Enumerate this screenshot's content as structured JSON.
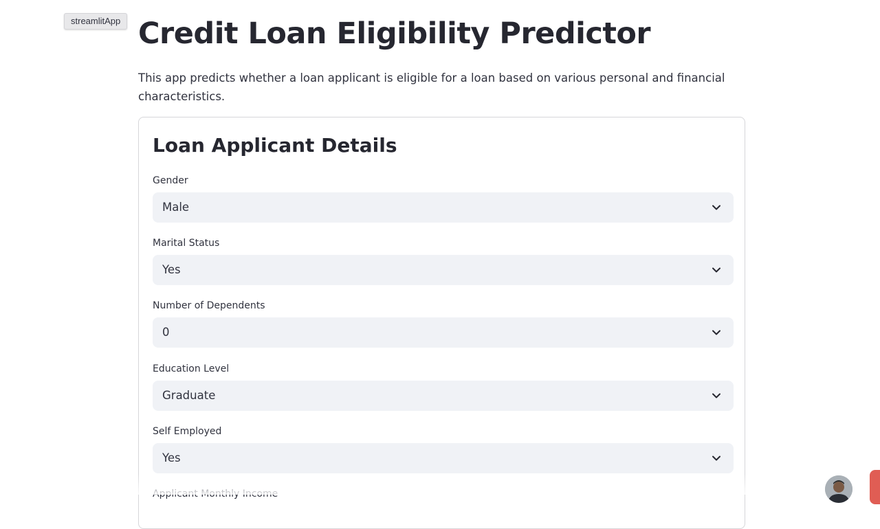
{
  "tooltip": {
    "label": "streamlitApp"
  },
  "header": {
    "title": "Credit Loan Eligibility Predictor",
    "description": "This app predicts whether a loan applicant is eligible for a loan based on various personal and financial characteristics."
  },
  "form": {
    "heading": "Loan Applicant Details",
    "fields": [
      {
        "label": "Gender",
        "value": "Male"
      },
      {
        "label": "Marital Status",
        "value": "Yes"
      },
      {
        "label": "Number of Dependents",
        "value": "0"
      },
      {
        "label": "Education Level",
        "value": "Graduate"
      },
      {
        "label": "Self Employed",
        "value": "Yes"
      },
      {
        "label": "Applicant Monthly Income"
      }
    ]
  },
  "icons": {
    "dropdown": "chevron-down-icon",
    "profile": "avatar",
    "action": "red-action-button"
  },
  "colors": {
    "select_bg": "#f0f2f6",
    "title_text": "#262730",
    "body_text": "#31333f",
    "accent_red": "#e05d54"
  }
}
